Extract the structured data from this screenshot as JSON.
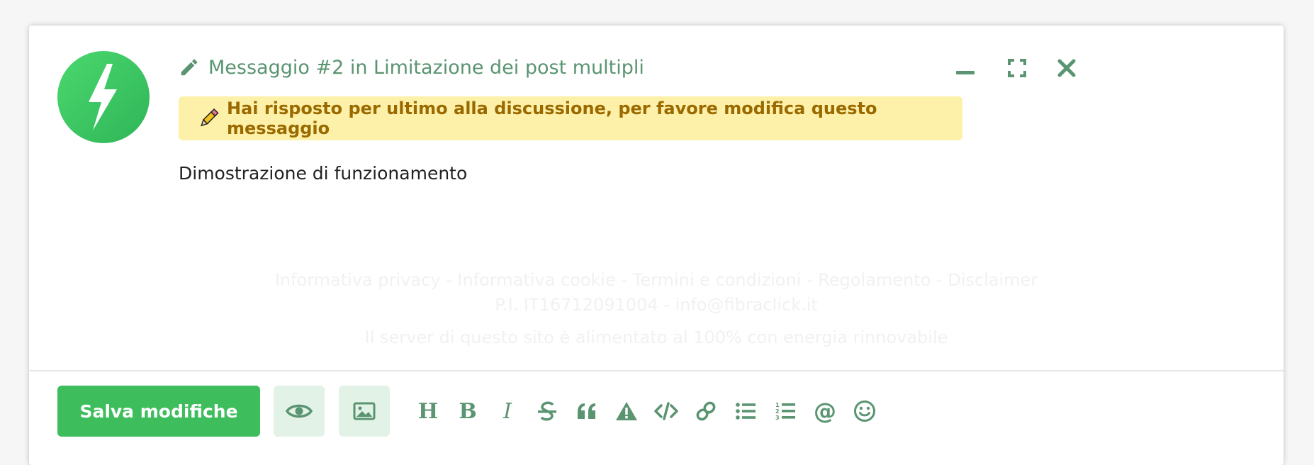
{
  "composer": {
    "title": "Messaggio #2 in Limitazione dei post multipli",
    "notice": "Hai risposto per ultimo alla discussione, per favore modifica questo messaggio",
    "body_text": "Dimostrazione di funzionamento",
    "window_controls": [
      "minimize-icon",
      "expand-icon",
      "close-icon"
    ]
  },
  "footer_ghost": {
    "line1": "Informativa privacy - Informativa cookie - Termini e condizioni - Regolamento - Disclaimer",
    "line2": "P.I. IT16712091004 - info@fibraclick.it",
    "line3": "Il server di questo sito è alimentato al 100% con energia rinnovabile"
  },
  "toolbar": {
    "save_label": "Salva modifiche",
    "buttons": [
      "preview-icon",
      "image-icon"
    ],
    "format_tools": [
      "heading-icon",
      "bold-icon",
      "italic-icon",
      "strikethrough-icon",
      "quote-icon",
      "warning-icon",
      "code-icon",
      "link-icon",
      "bullet-list-icon",
      "numbered-list-icon",
      "mention-icon",
      "emoji-icon"
    ]
  },
  "colors": {
    "accent": "#3dbd5c",
    "icon": "#5a9471",
    "notice_bg": "#fdf0a8",
    "notice_text": "#9a6a00"
  }
}
